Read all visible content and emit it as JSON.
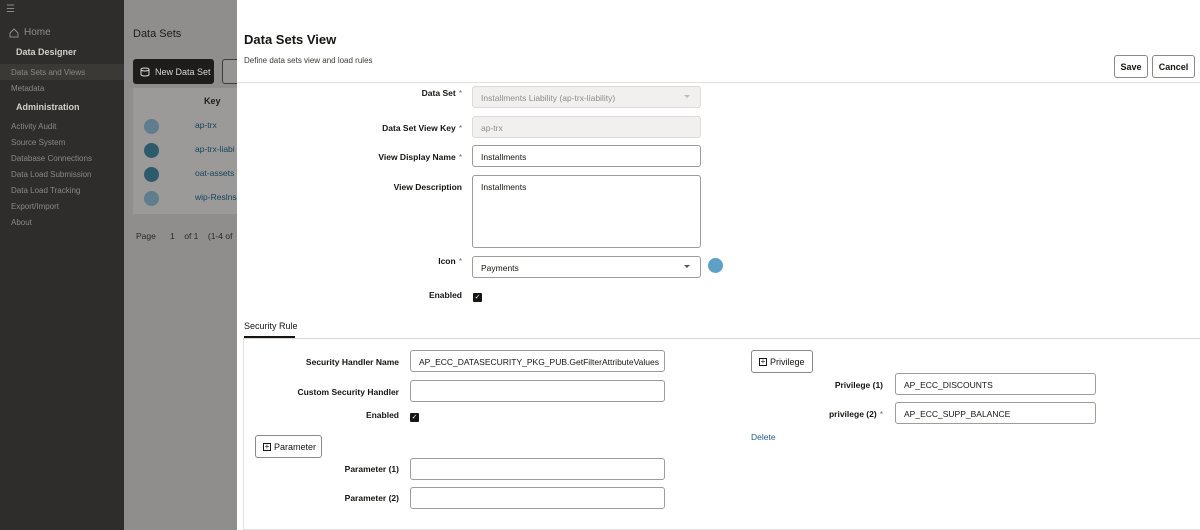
{
  "sidebar": {
    "home": "Home",
    "section_data_designer": "Data Designer",
    "items_designer": [
      "Data Sets and Views",
      "Metadata"
    ],
    "section_admin": "Administration",
    "items_admin": [
      "Activity Audit",
      "Source System",
      "Database Connections",
      "Data Load Submission",
      "Data Load Tracking",
      "Export/Import",
      "About"
    ]
  },
  "list": {
    "title": "Data Sets",
    "new_button": "New Data Set",
    "col_key": "Key",
    "rows": [
      "ap-trx",
      "ap-trx-liabi",
      "oat-assets",
      "wip-Reslns"
    ],
    "pager_label": "Page",
    "pager_page": "1",
    "pager_of": "of 1",
    "pager_range": "(1-4 of"
  },
  "panel": {
    "title": "Data Sets View",
    "subtitle": "Define data sets view and load rules",
    "save": "Save",
    "cancel": "Cancel",
    "data_set_label": "Data Set",
    "data_set_value": "Installments Liability (ap-trx-liability)",
    "view_key_label": "Data Set View Key",
    "view_key_value": "ap-trx",
    "display_name_label": "View Display Name",
    "display_name_value": "Installments",
    "description_label": "View Description",
    "description_value": "Installments",
    "icon_label": "Icon",
    "icon_value": "Payments",
    "enabled_label": "Enabled",
    "required_mark": "*"
  },
  "security": {
    "tab": "Security Rule",
    "handler_label": "Security Handler Name",
    "handler_value": "AP_ECC_DATASECURITY_PKG_PUB.GetFilterAttributeValues",
    "custom_label": "Custom Security Handler",
    "custom_value": "",
    "enabled_label": "Enabled",
    "parameter_button": "Parameter",
    "param1_label": "Parameter (1)",
    "param1_value": "",
    "param2_label": "Parameter (2)",
    "param2_value": "",
    "privilege_button": "Privilege",
    "priv1_label": "Privilege (1)",
    "priv1_value": "AP_ECC_DISCOUNTS",
    "priv2_label": "privilege (2)",
    "priv2_value": "AP_ECC_SUPP_BALANCE",
    "delete_link": "Delete"
  }
}
